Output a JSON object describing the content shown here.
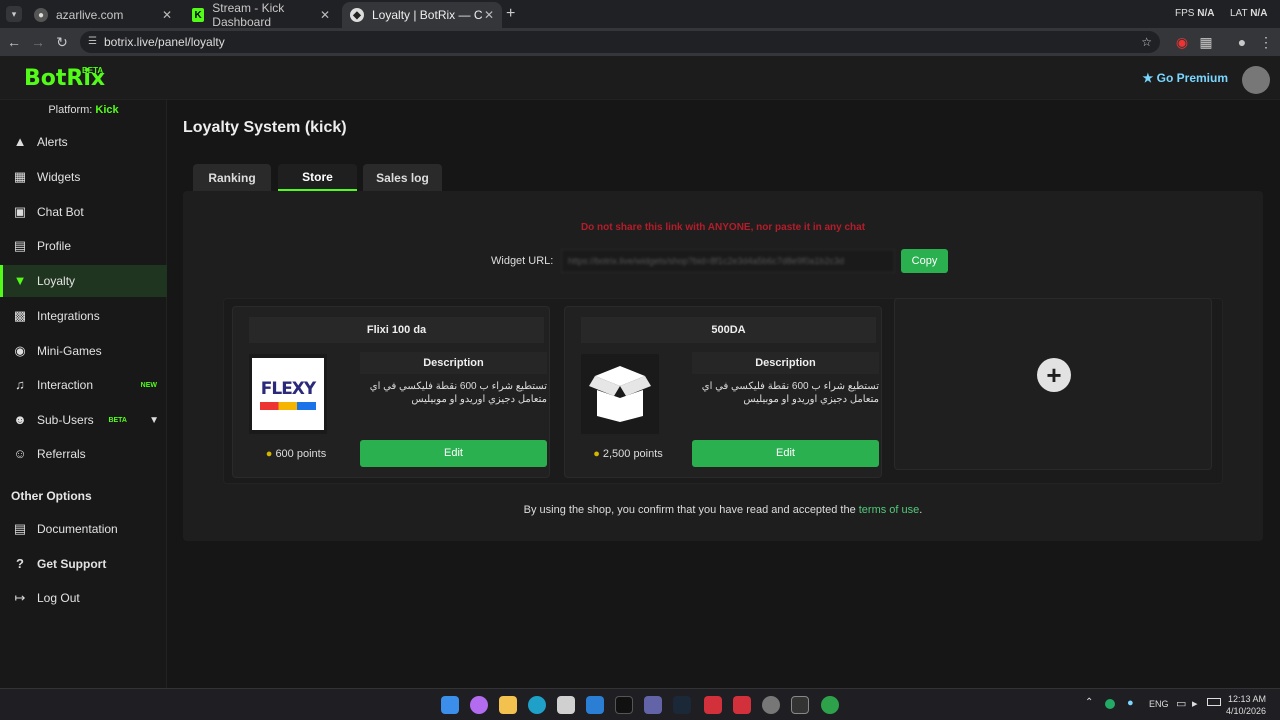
{
  "browser": {
    "tabs": [
      {
        "title": "azarlive.com"
      },
      {
        "title": "Stream - Kick Dashboard"
      },
      {
        "title": "Loyalty | BotRix — Cloud Stream"
      }
    ],
    "url": "botrix.live/panel/loyalty",
    "fps_label": "FPS",
    "fps_value": "N/A",
    "lat_label": "LAT",
    "lat_value": "N/A"
  },
  "app": {
    "logo": "BotRix",
    "logo_badge": "BETA",
    "go_premium": "Go Premium"
  },
  "sidebar": {
    "platform_label": "Platform:",
    "platform_value": "Kick",
    "items": [
      {
        "label": "Alerts",
        "icon": "warning-icon"
      },
      {
        "label": "Widgets",
        "icon": "widgets-icon"
      },
      {
        "label": "Chat Bot",
        "icon": "robot-icon"
      },
      {
        "label": "Profile",
        "icon": "profile-card-icon"
      },
      {
        "label": "Loyalty",
        "icon": "trophy-icon"
      },
      {
        "label": "Integrations",
        "icon": "integrations-icon"
      },
      {
        "label": "Mini-Games",
        "icon": "gamepad-icon"
      },
      {
        "label": "Interaction",
        "icon": "music-icon",
        "badge": "NEW"
      },
      {
        "label": "Sub-Users",
        "icon": "users-icon",
        "badge": "BETA"
      },
      {
        "label": "Referrals",
        "icon": "referrals-icon"
      }
    ],
    "other_options_title": "Other Options",
    "other_items": [
      {
        "label": "Documentation",
        "icon": "book-icon"
      },
      {
        "label": "Get Support",
        "icon": "help-icon"
      },
      {
        "label": "Log Out",
        "icon": "logout-icon"
      }
    ]
  },
  "main": {
    "page_title": "Loyalty System (kick)",
    "tabs": [
      {
        "label": "Ranking"
      },
      {
        "label": "Store"
      },
      {
        "label": "Sales log"
      }
    ],
    "warning": "Do not share this link with ANYONE, nor paste it in any chat",
    "widget_url_label": "Widget URL:",
    "widget_url_value": "https://botrix.live/widgets/shop?bid=8f1c2e3d4a5b6c7d8e9f0a1b2c3d",
    "copy_label": "Copy",
    "items": [
      {
        "name": "Flixi 100 da",
        "description_title": "Description",
        "description": "تستطيع شراء ب 600 نقطة فليكسي في اي متعامل دجيزي اوريدو او موبيليس",
        "points": "600 points",
        "edit_label": "Edit",
        "image_text": "FLEXY"
      },
      {
        "name": "500DA",
        "description_title": "Description",
        "description": "تستطيع شراء ب 600 نقطة فليكسي في اي متعامل دجيزي اوريدو او موبيليس",
        "points": "2,500 points",
        "edit_label": "Edit"
      }
    ],
    "terms_text": "By using the shop, you confirm that you have read and accepted the",
    "terms_link": "terms of use",
    "terms_end": "."
  },
  "taskbar": {
    "lang": "ENG",
    "time": "12:13 AM",
    "date": "4/10/2026"
  }
}
